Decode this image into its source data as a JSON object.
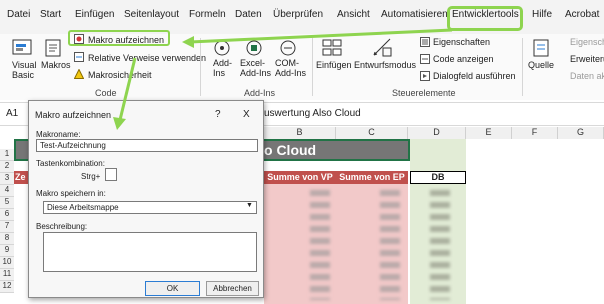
{
  "tabs": [
    "Datei",
    "Start",
    "Einfügen",
    "Seitenlayout",
    "Formeln",
    "Daten",
    "Überprüfen",
    "Ansicht",
    "Automatisieren",
    "Entwicklertools",
    "Hilfe",
    "Acrobat"
  ],
  "ribbon": {
    "visual_basic": "Visual Basic",
    "makros": "Makros",
    "makro_aufzeichnen": "Makro aufzeichnen",
    "relative_verweise": "Relative Verweise verwenden",
    "makrosicherheit": "Makrosicherheit",
    "add_ins": "Add-Ins",
    "excel_add_ins": "Excel-Add-Ins",
    "com_add_ins": "COM-Add-Ins",
    "einfuegen": "Einfügen",
    "entwurfsmodus": "Entwurfsmodus",
    "eigenschaften": "Eigenschaften",
    "code_anzeigen": "Code anzeigen",
    "dialogfeld": "Dialogfeld ausführen",
    "quelle": "Quelle",
    "eigensch_cut": "Eigensch",
    "erweiter_cut": "Erweiteru",
    "daten_cut": "Daten ak",
    "grp_code": "Code",
    "grp_addins": "Add-Ins",
    "grp_steuer": "Steuerelemente"
  },
  "formula_bar": {
    "cell_ref": "A1",
    "content": "uswertung Also Cloud"
  },
  "columns": [
    "B",
    "C",
    "D",
    "E",
    "F",
    "G"
  ],
  "rows": [
    "1",
    "2",
    "3",
    "4",
    "5",
    "6",
    "7",
    "8",
    "9",
    "10",
    "11",
    "12"
  ],
  "sheet": {
    "title_tail": "o Cloud",
    "row3_a": "Ze",
    "summe_vp": "Summe von VP",
    "summe_ep": "Summe von EP",
    "db": "DB"
  },
  "dialog": {
    "title": "Makro aufzeichnen",
    "help": "?",
    "close": "X",
    "makroname_label": "Makroname:",
    "makroname_value": "Test-Aufzeichnung",
    "tastenkombination_label": "Tastenkombination:",
    "strg_label": "Strg+",
    "speichern_label": "Makro speichern in:",
    "speichern_value": "Diese Arbeitsmappe",
    "beschreibung_label": "Beschreibung:",
    "ok": "OK",
    "abbrechen": "Abbrechen"
  },
  "colors": {
    "accent_green": "#8ed44f",
    "title_bar": "#767676",
    "vp_fill": "#f2c9c9",
    "db_fill": "#e2ecd6",
    "header_red": "#c0504d"
  }
}
